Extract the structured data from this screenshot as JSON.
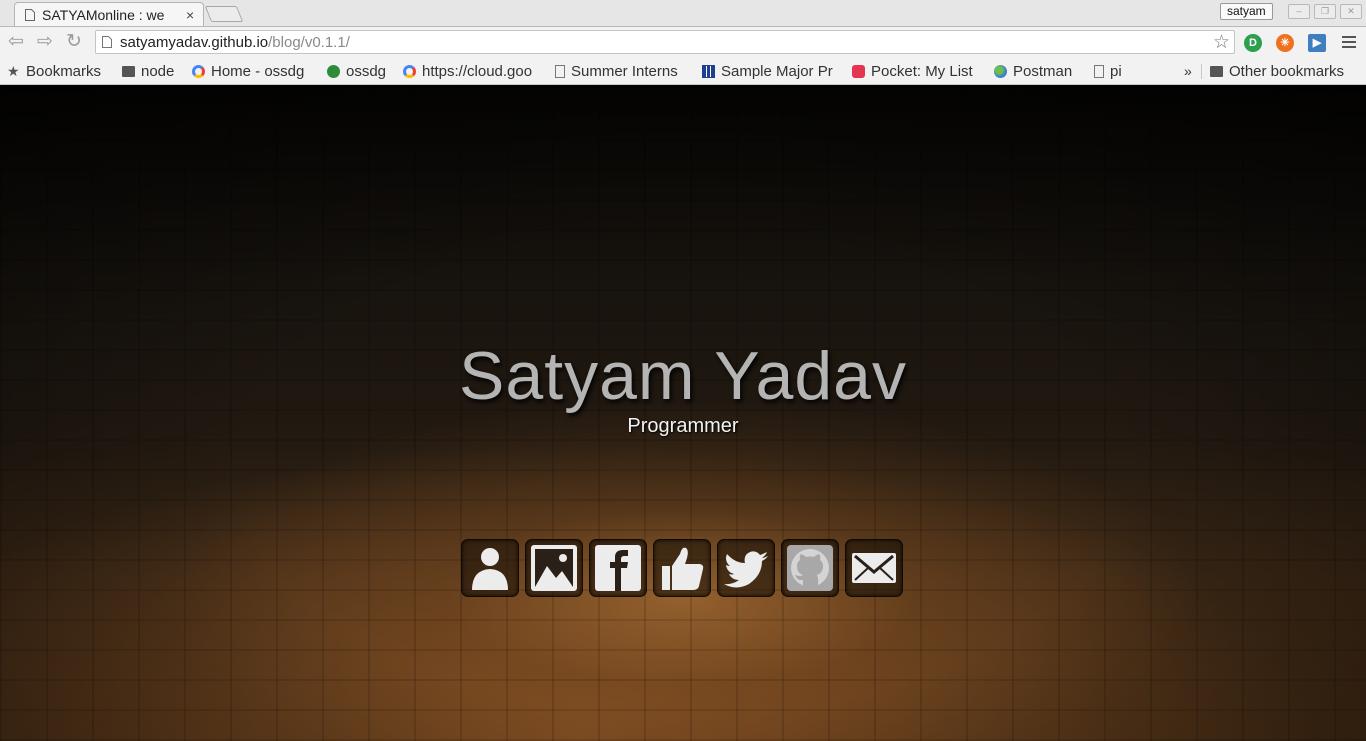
{
  "browser": {
    "tab_title": "SATYAMonline : we",
    "tab_close": "×",
    "user_name": "satyam",
    "url_host": "satyamyadav.github.io",
    "url_path": "/blog/v0.1.1/",
    "star_glyph": "☆"
  },
  "bookmarks": {
    "items": [
      {
        "label": "Bookmarks",
        "icon": "star-icon"
      },
      {
        "label": "node",
        "icon": "folder-icon"
      },
      {
        "label": "Home - ossdg",
        "icon": "google-icon"
      },
      {
        "label": "ossdg",
        "icon": "github-dot-icon"
      },
      {
        "label": "https://cloud.goo",
        "icon": "google-icon"
      },
      {
        "label": "Summer Interns",
        "icon": "page-icon"
      },
      {
        "label": "Sample Major Pr",
        "icon": "grid-icon"
      },
      {
        "label": "Pocket: My List",
        "icon": "pocket-icon"
      },
      {
        "label": "Postman",
        "icon": "globe-icon"
      },
      {
        "label": "pi",
        "icon": "page-icon"
      }
    ],
    "overflow": "»",
    "other": "Other bookmarks"
  },
  "hero": {
    "name": "Satyam Yadav",
    "role": "Programmer"
  },
  "social_icons": [
    "user-icon",
    "gallery-icon",
    "facebook-icon",
    "like-icon",
    "twitter-icon",
    "github-icon",
    "mail-icon"
  ],
  "colors": {
    "name_text": "#b4b4b4",
    "role_text": "#f2f2f2",
    "icon_fill": "#ececec",
    "github_bg": "#a8a8a8"
  }
}
